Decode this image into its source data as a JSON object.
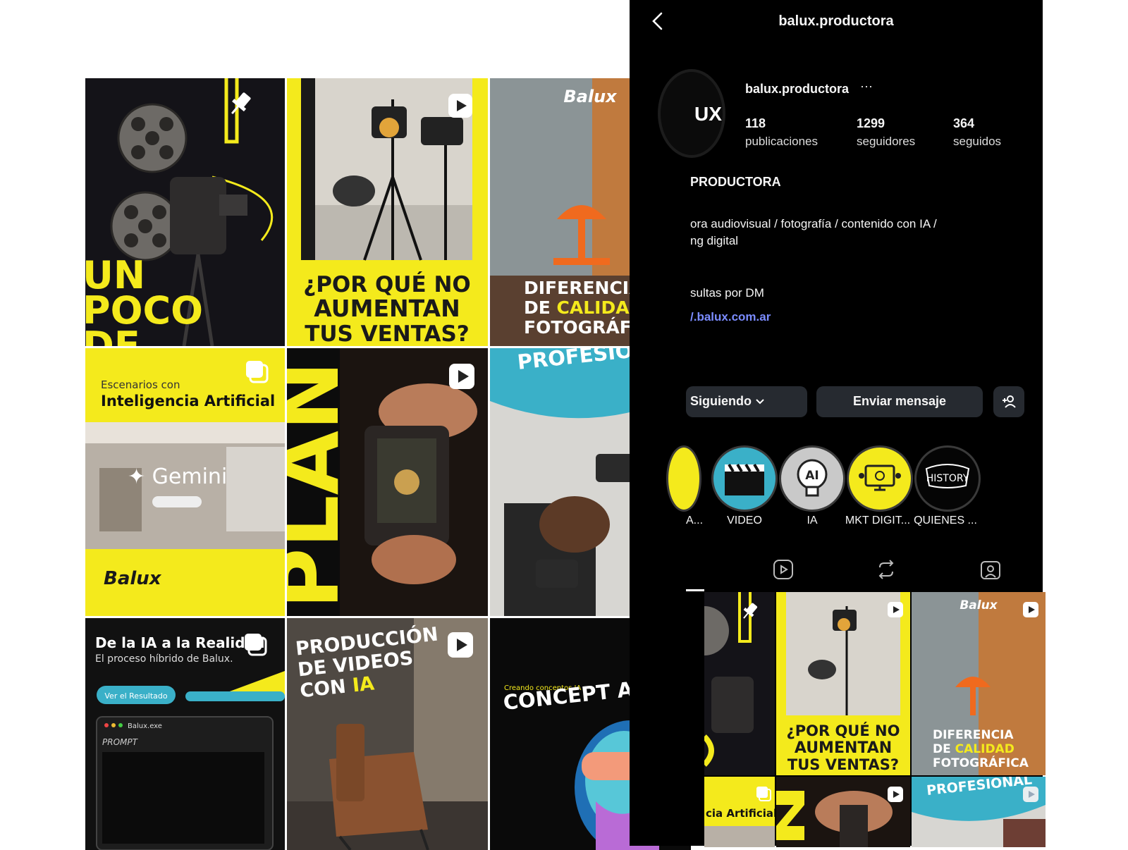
{
  "profile": {
    "header_username": "balux.productora",
    "username": "balux.productora",
    "more": "···",
    "avatar_text": "UX",
    "posts_count": "118",
    "posts_label": "publicaciones",
    "followers_count": "1299",
    "followers_label": "seguidores",
    "following_count": "364",
    "following_label": "seguidos",
    "name": "PRODUCTORA",
    "bio_line1": "ora audiovisual / fotografía / contenido con IA /",
    "bio_line2": "ng digital",
    "bio_line3": "sultas por DM",
    "link": "/.balux.com.ar"
  },
  "actions": {
    "following_label": "Siguiendo",
    "message_label": "Enviar mensaje"
  },
  "highlights": [
    {
      "label": "A..."
    },
    {
      "label": "VIDEO"
    },
    {
      "label": "IA"
    },
    {
      "label": "MKT DIGIT..."
    },
    {
      "label": "QUIENES ..."
    }
  ],
  "highlight_glyphs": {
    "ia": "AI",
    "history": "HISTORY"
  },
  "posts": {
    "p1": {
      "text_a": "UN",
      "text_b": "POCO",
      "text_c": "DE"
    },
    "p2": {
      "line1": "¿POR QUÉ NO",
      "line2": "AUMENTAN",
      "line3": "TUS VENTAS?"
    },
    "p3": {
      "logo": "Balux",
      "line1": "DIFERENCIA",
      "line2_a": "DE ",
      "line2_b": "CALIDAD",
      "line3": "FOTOGRÁFICA"
    },
    "p4": {
      "small": "Escenarios con",
      "title": "Inteligencia Artificial",
      "gemini": "✦ Gemini",
      "logo": "Balux"
    },
    "p5": {
      "word": "PLAN"
    },
    "p6": {
      "title": "PROFESIONAL"
    },
    "p7": {
      "title": "De la IA a la Realidad",
      "subtitle": "El proceso híbrido de Balux.",
      "button": "Ver el Resultado",
      "window": "Balux.exe",
      "prompt": "PROMPT"
    },
    "p8": {
      "line1": "PRODUCCIÓN",
      "line2": "DE VIDEOS",
      "line3_a": "CON ",
      "line3_b": "IA"
    },
    "p9": {
      "kicker": "Creando conceptos IA",
      "title": "CONCEPT ART"
    }
  },
  "small_grid": {
    "s2": {
      "line1": "¿POR QUÉ NO",
      "line2": "AUMENTAN",
      "line3": "TUS VENTAS?"
    },
    "s3": {
      "logo": "Balux",
      "line1": "DIFERENCIA",
      "line2_a": "DE ",
      "line2_b": "CALIDAD",
      "line3": "FOTOGRÁFICA"
    },
    "s4": {
      "title": "cia Artificial"
    },
    "s6": {
      "title": "PROFESIONAL"
    }
  },
  "colors": {
    "brand_yellow": "#f4ea1c",
    "accent_teal": "#3ab0c8",
    "link_blue": "#7b8cff",
    "phone_bg": "#000000"
  }
}
